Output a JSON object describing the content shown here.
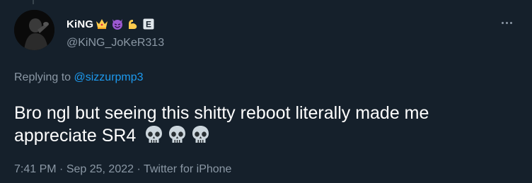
{
  "author": {
    "display_name": "KiNG",
    "badges": [
      "crown-emoji",
      "smiling-imp-emoji",
      "flexed-biceps-emoji",
      "letter-e-box"
    ],
    "badge_letter": "E",
    "handle": "@KiNG_JoKeR313"
  },
  "reply": {
    "prefix": "Replying to ",
    "mention": "@sizzurpmp3"
  },
  "tweet": {
    "text": "Bro ngl but seeing this shitty reboot literally made me appreciate SR4",
    "emojis": [
      "skull",
      "skull",
      "skull"
    ]
  },
  "meta": {
    "time": "7:41 PM",
    "separator": " · ",
    "date": "Sep 25, 2022",
    "source": "Twitter for iPhone"
  },
  "colors": {
    "background": "#15202b",
    "text": "#ffffff",
    "secondary": "#8b98a5",
    "link": "#1d9bf0"
  }
}
